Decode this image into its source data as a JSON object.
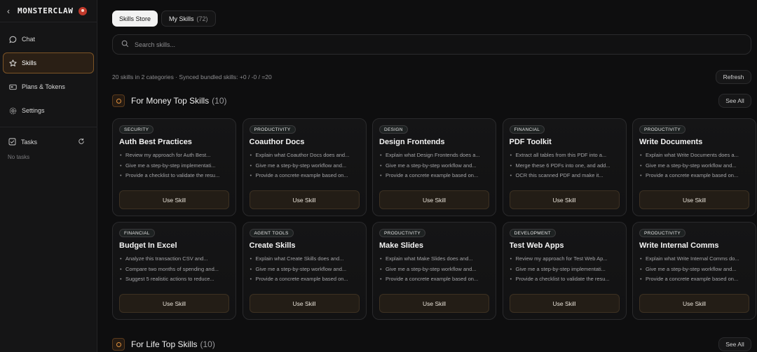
{
  "brand": {
    "back_glyph": "‹",
    "name": "MONSTERCLAW"
  },
  "sidebar": {
    "items": [
      {
        "label": "Chat",
        "icon": "chat-bubble-icon"
      },
      {
        "label": "Skills",
        "icon": "star-icon",
        "active": true
      },
      {
        "label": "Plans & Tokens",
        "icon": "card-icon"
      },
      {
        "label": "Settings",
        "icon": "gear-icon"
      }
    ],
    "tasks_label": "Tasks",
    "no_tasks": "No tasks"
  },
  "tabs": [
    {
      "label": "Skills Store",
      "active": true
    },
    {
      "label": "My Skills",
      "count": "(72)"
    }
  ],
  "search": {
    "placeholder": "Search skills..."
  },
  "status_text": "20 skills in 2 categories · Synced bundled skills: +0 / -0 / =20",
  "refresh_label": "Refresh",
  "sections": [
    {
      "title": "For Money Top Skills",
      "count": "(10)",
      "see_all": "See All"
    },
    {
      "title": "For Life Top Skills",
      "count": "(10)",
      "see_all": "See All"
    }
  ],
  "use_label": "Use Skill",
  "cards": [
    {
      "badge": "SECURITY",
      "title": "Auth Best Practices",
      "bullets": [
        "Review my approach for Auth Best...",
        "Give me a step-by-step implementati...",
        "Provide a checklist to validate the resu..."
      ]
    },
    {
      "badge": "PRODUCTIVITY",
      "title": "Coauthor Docs",
      "bullets": [
        "Explain what Coauthor Docs does and...",
        "Give me a step-by-step workflow and...",
        "Provide a concrete example based on..."
      ]
    },
    {
      "badge": "DESIGN",
      "title": "Design Frontends",
      "bullets": [
        "Explain what Design Frontends does a...",
        "Give me a step-by-step workflow and...",
        "Provide a concrete example based on..."
      ]
    },
    {
      "badge": "FINANCIAL",
      "title": "PDF Toolkit",
      "bullets": [
        "Extract all tables from this PDF into a...",
        "Merge these 6 PDFs into one, and add...",
        "OCR this scanned PDF and make it..."
      ]
    },
    {
      "badge": "PRODUCTIVITY",
      "title": "Write Documents",
      "bullets": [
        "Explain what Write Documents does a...",
        "Give me a step-by-step workflow and...",
        "Provide a concrete example based on..."
      ]
    },
    {
      "badge": "FINANCIAL",
      "title": "Budget In Excel",
      "bullets": [
        "Analyze this transaction CSV and...",
        "Compare two months of spending and...",
        "Suggest 5 realistic actions to reduce..."
      ]
    },
    {
      "badge": "AGENT TOOLS",
      "title": "Create Skills",
      "bullets": [
        "Explain what Create Skills does and...",
        "Give me a step-by-step workflow and...",
        "Provide a concrete example based on..."
      ]
    },
    {
      "badge": "PRODUCTIVITY",
      "title": "Make Slides",
      "bullets": [
        "Explain what Make Slides does and...",
        "Give me a step-by-step workflow and...",
        "Provide a concrete example based on..."
      ]
    },
    {
      "badge": "DEVELOPMENT",
      "title": "Test Web Apps",
      "bullets": [
        "Review my approach for Test Web Ap...",
        "Give me a step-by-step implementati...",
        "Provide a checklist to validate the resu..."
      ]
    },
    {
      "badge": "PRODUCTIVITY",
      "title": "Write Internal Comms",
      "bullets": [
        "Explain what Write Internal Comms do...",
        "Give me a step-by-step workflow and...",
        "Provide a concrete example based on..."
      ]
    }
  ]
}
